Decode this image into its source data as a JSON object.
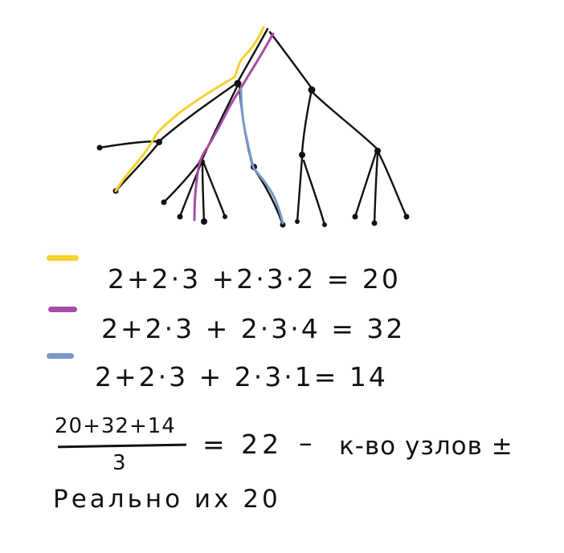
{
  "legend": [
    {
      "color": "#f5d22d",
      "expression": "2+2·3 +2·3·2 = 20"
    },
    {
      "color": "#a64ca6",
      "expression": "2+2·3 + 2·3·4 = 32"
    },
    {
      "color": "#7a99c9",
      "expression": "2+2·3 + 2·3·1= 14"
    }
  ],
  "average": {
    "numerator": "20+32+14",
    "denominator": "3",
    "result": "= 22",
    "dash": "–",
    "label": "к-во узлов ±"
  },
  "conclusion": "Реально их 20",
  "colors": {
    "ink": "#111111",
    "yellow": "#f5d22d",
    "purple": "#a64ca6",
    "blue": "#7a99c9"
  }
}
